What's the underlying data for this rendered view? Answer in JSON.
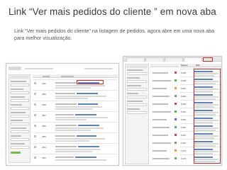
{
  "slide": {
    "title": "Link “Ver mais pedidos do cliente ” em nova aba",
    "description": "Link “Ver mais pedidos do cliente” na listagem de pedidos, agora abre em uma nova aba para melhor visualização."
  },
  "left_screenshot": {
    "order_numbers": [
      "3890",
      "3889",
      "3888",
      "3887",
      "3886",
      "3885",
      "3884",
      "3883"
    ]
  },
  "right_screenshot": {
    "column_headers": [
      "Numero",
      "Data"
    ],
    "order_numbers": [
      "81989",
      "81988",
      "81987",
      "81986",
      "81985",
      "81984",
      "81983",
      "81982",
      "81981",
      "81980",
      "81979",
      "81978"
    ]
  },
  "colors": {
    "highlight": "#e02020",
    "link": "#5a82c8",
    "button": "#78b848"
  }
}
